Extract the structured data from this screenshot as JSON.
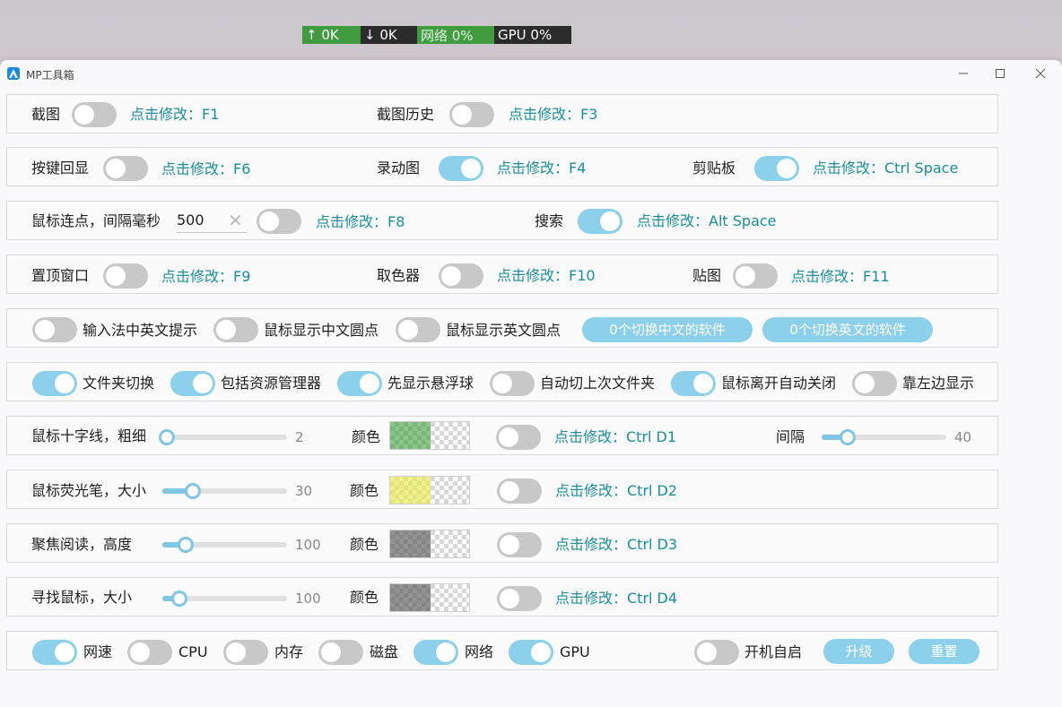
{
  "netbar": {
    "up": "↑ 0K",
    "down": "↓ 0K",
    "net": "网络 0%",
    "gpu": "GPU 0%"
  },
  "window": {
    "title": "MP工具箱"
  },
  "colors": {
    "accent": "#8cd0ec",
    "hotkey": "#1a8e9a",
    "toggle_off": "#c8c8c8"
  },
  "row1": {
    "screenshot": "截图",
    "screenshot_key": "点击修改：F1",
    "history": "截图历史",
    "history_key": "点击修改：F3"
  },
  "row2": {
    "key_echo": "按键回显",
    "key_echo_key": "点击修改：F6",
    "gif": "录动图",
    "gif_key": "点击修改：F4",
    "clipboard": "剪贴板",
    "clipboard_key": "点击修改：Ctrl Space"
  },
  "row3": {
    "autoclick": "鼠标连点，间隔毫秒",
    "interval": "500",
    "clear_icon": "✕",
    "autoclick_key": "点击修改：F8",
    "search": "搜索",
    "search_key": "点击修改：Alt Space"
  },
  "row4": {
    "topmost": "置顶窗口",
    "topmost_key": "点击修改：F9",
    "picker": "取色器",
    "picker_key": "点击修改：F10",
    "pin": "贴图",
    "pin_key": "点击修改：F11"
  },
  "row5": {
    "ime_hint": "输入法中英文提示",
    "cn_dot": "鼠标显示中文圆点",
    "en_dot": "鼠标显示英文圆点",
    "cn_apps": "0个切换中文的软件",
    "en_apps": "0个切换英文的软件"
  },
  "row6": {
    "folder_switch": "文件夹切换",
    "explorer": "包括资源管理器",
    "float_ball": "先显示悬浮球",
    "last_folder": "自动切上次文件夹",
    "auto_close": "鼠标离开自动关闭",
    "left_show": "靠左边显示"
  },
  "row7": {
    "crosshair": "鼠标十字线，粗细",
    "thickness": "2",
    "color": "颜色",
    "key": "点击修改：Ctrl D1",
    "gap": "间隔",
    "gap_val": "40"
  },
  "row8": {
    "highlighter": "鼠标荧光笔，大小",
    "size": "30",
    "color": "颜色",
    "key": "点击修改：Ctrl D2"
  },
  "row9": {
    "focus": "聚焦阅读，高度",
    "height": "100",
    "color": "颜色",
    "key": "点击修改：Ctrl D3"
  },
  "row10": {
    "find": "寻找鼠标，大小",
    "size": "100",
    "color": "颜色",
    "key": "点击修改：Ctrl D4"
  },
  "row11": {
    "speed": "网速",
    "cpu": "CPU",
    "mem": "内存",
    "disk": "磁盘",
    "net": "网络",
    "gpu": "GPU",
    "autostart": "开机自启",
    "upgrade": "升级",
    "reset": "重置"
  }
}
